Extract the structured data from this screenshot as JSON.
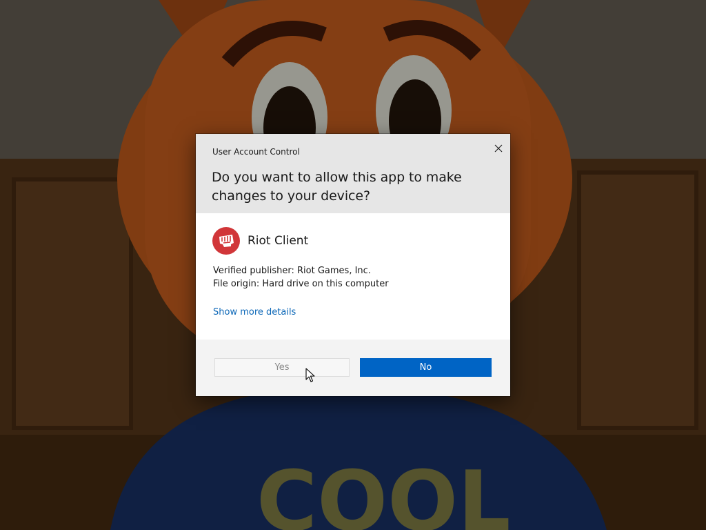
{
  "dialog": {
    "title": "User Account Control",
    "question": "Do you want to allow this app to make changes to your device?",
    "close_icon": "close-icon"
  },
  "app": {
    "name": "Riot Client",
    "logo_icon": "riot-fist-logo",
    "publisher_line": "Verified publisher: Riot Games, Inc.",
    "origin_line": "File origin: Hard drive on this computer",
    "details_link": "Show more details"
  },
  "buttons": {
    "yes_label": "Yes",
    "no_label": "No"
  },
  "background": {
    "shirt_text": "COOL"
  },
  "colors": {
    "accent": "#0064c5",
    "link": "#0a66b7",
    "riot_red": "#d13639",
    "header_bg": "#e6e6e6",
    "footer_bg": "#f3f3f3"
  }
}
